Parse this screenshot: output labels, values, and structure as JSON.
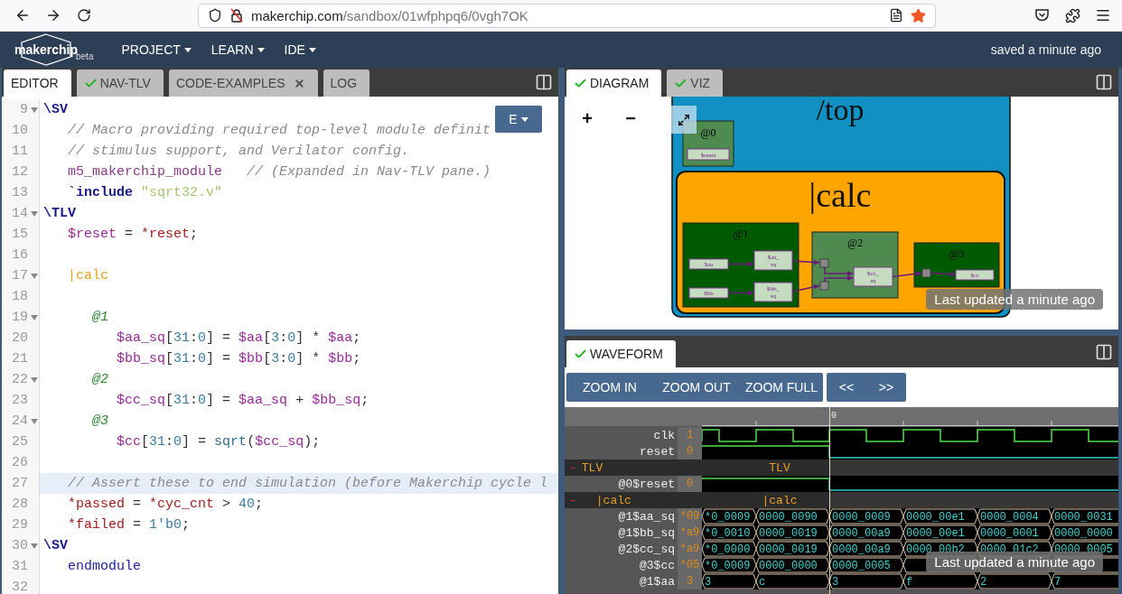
{
  "browser": {
    "url_host": "makerchip.com",
    "url_path": "/sandbox/01wfphpq6/0vgh7OK",
    "bookmarked": true
  },
  "navbar": {
    "logo": "makerchip",
    "badge": "beta",
    "menus": [
      "PROJECT",
      "LEARN",
      "IDE"
    ],
    "status": "saved a minute ago"
  },
  "editor": {
    "tabs": [
      {
        "label": "EDITOR",
        "selected": true,
        "ok": false,
        "closable": false
      },
      {
        "label": "NAV-TLV",
        "selected": false,
        "ok": true,
        "closable": false
      },
      {
        "label": "CODE-EXAMPLES",
        "selected": false,
        "ok": false,
        "closable": true
      },
      {
        "label": "LOG",
        "selected": false,
        "ok": false,
        "closable": false
      }
    ],
    "mode_button": "E",
    "lines": [
      {
        "number": "9",
        "fold": true,
        "active": false,
        "tokens": [
          {
            "kind": "kw",
            "text": "\\SV"
          }
        ]
      },
      {
        "number": "10",
        "fold": false,
        "active": false,
        "tokens": [
          {
            "kind": "cm",
            "text": "   // Macro providing required top-level module definit"
          }
        ]
      },
      {
        "number": "11",
        "fold": false,
        "active": false,
        "tokens": [
          {
            "kind": "cm",
            "text": "   // stimulus support, and Verilator config."
          }
        ]
      },
      {
        "number": "12",
        "fold": false,
        "active": false,
        "tokens": [
          {
            "kind": "macro",
            "text": "   m5_makerchip_module"
          },
          {
            "kind": "cm",
            "text": "   // (Expanded in Nav-TLV pane.)"
          }
        ]
      },
      {
        "number": "13",
        "fold": false,
        "active": false,
        "tokens": [
          {
            "kind": "kw",
            "text": "   `include "
          },
          {
            "kind": "str",
            "text": "\"sqrt32.v\""
          }
        ]
      },
      {
        "number": "14",
        "fold": true,
        "active": false,
        "tokens": [
          {
            "kind": "kw",
            "text": "\\TLV"
          }
        ]
      },
      {
        "number": "15",
        "fold": false,
        "active": false,
        "tokens": [
          {
            "kind": "sig",
            "text": "   $reset"
          },
          {
            "kind": "op",
            "text": " = "
          },
          {
            "kind": "ext",
            "text": "*reset"
          },
          {
            "kind": "op",
            "text": ";"
          }
        ]
      },
      {
        "number": "16",
        "fold": false,
        "active": false
      },
      {
        "number": "17",
        "fold": true,
        "active": false,
        "tokens": [
          {
            "kind": "pipe",
            "text": "   |calc"
          }
        ]
      },
      {
        "number": "18",
        "fold": false,
        "active": false
      },
      {
        "number": "19",
        "fold": true,
        "active": false,
        "tokens": [
          {
            "kind": "stage",
            "text": "      @1"
          }
        ]
      },
      {
        "number": "20",
        "fold": false,
        "active": false,
        "tokens": [
          {
            "kind": "sig",
            "text": "         $aa_sq"
          },
          {
            "kind": "op",
            "text": "["
          },
          {
            "kind": "num",
            "text": "31"
          },
          {
            "kind": "op",
            "text": ":"
          },
          {
            "kind": "num",
            "text": "0"
          },
          {
            "kind": "op",
            "text": "] = "
          },
          {
            "kind": "sig",
            "text": "$aa"
          },
          {
            "kind": "op",
            "text": "["
          },
          {
            "kind": "num",
            "text": "3"
          },
          {
            "kind": "op",
            "text": ":"
          },
          {
            "kind": "num",
            "text": "0"
          },
          {
            "kind": "op",
            "text": "] * "
          },
          {
            "kind": "sig",
            "text": "$aa"
          },
          {
            "kind": "op",
            "text": ";"
          }
        ]
      },
      {
        "number": "21",
        "fold": false,
        "active": false,
        "tokens": [
          {
            "kind": "sig",
            "text": "         $bb_sq"
          },
          {
            "kind": "op",
            "text": "["
          },
          {
            "kind": "num",
            "text": "31"
          },
          {
            "kind": "op",
            "text": ":"
          },
          {
            "kind": "num",
            "text": "0"
          },
          {
            "kind": "op",
            "text": "] = "
          },
          {
            "kind": "sig",
            "text": "$bb"
          },
          {
            "kind": "op",
            "text": "["
          },
          {
            "kind": "num",
            "text": "3"
          },
          {
            "kind": "op",
            "text": ":"
          },
          {
            "kind": "num",
            "text": "0"
          },
          {
            "kind": "op",
            "text": "] * "
          },
          {
            "kind": "sig",
            "text": "$bb"
          },
          {
            "kind": "op",
            "text": ";"
          }
        ]
      },
      {
        "number": "22",
        "fold": true,
        "active": false,
        "tokens": [
          {
            "kind": "stage",
            "text": "      @2"
          }
        ]
      },
      {
        "number": "23",
        "fold": false,
        "active": false,
        "tokens": [
          {
            "kind": "sig",
            "text": "         $cc_sq"
          },
          {
            "kind": "op",
            "text": "["
          },
          {
            "kind": "num",
            "text": "31"
          },
          {
            "kind": "op",
            "text": ":"
          },
          {
            "kind": "num",
            "text": "0"
          },
          {
            "kind": "op",
            "text": "] = "
          },
          {
            "kind": "sig",
            "text": "$aa_sq"
          },
          {
            "kind": "op",
            "text": " + "
          },
          {
            "kind": "sig",
            "text": "$bb_sq"
          },
          {
            "kind": "op",
            "text": ";"
          }
        ]
      },
      {
        "number": "24",
        "fold": true,
        "active": false,
        "tokens": [
          {
            "kind": "stage",
            "text": "      @3"
          }
        ]
      },
      {
        "number": "25",
        "fold": false,
        "active": false,
        "tokens": [
          {
            "kind": "sig",
            "text": "         $cc"
          },
          {
            "kind": "op",
            "text": "["
          },
          {
            "kind": "num",
            "text": "31"
          },
          {
            "kind": "op",
            "text": ":"
          },
          {
            "kind": "num",
            "text": "0"
          },
          {
            "kind": "op",
            "text": "] = "
          },
          {
            "kind": "fn",
            "text": "sqrt"
          },
          {
            "kind": "op",
            "text": "("
          },
          {
            "kind": "sig",
            "text": "$cc_sq"
          },
          {
            "kind": "op",
            "text": ");"
          }
        ]
      },
      {
        "number": "26",
        "fold": false,
        "active": false
      },
      {
        "number": "27",
        "fold": false,
        "active": true,
        "tokens": [
          {
            "kind": "cm",
            "text": "   // Assert these to end simulation (before Makerchip cycle l"
          }
        ]
      },
      {
        "number": "28",
        "fold": false,
        "active": false,
        "tokens": [
          {
            "kind": "ext",
            "text": "   *passed"
          },
          {
            "kind": "op",
            "text": " = "
          },
          {
            "kind": "ext",
            "text": "*cyc_cnt"
          },
          {
            "kind": "op",
            "text": " > "
          },
          {
            "kind": "num",
            "text": "40"
          },
          {
            "kind": "op",
            "text": ";"
          }
        ]
      },
      {
        "number": "29",
        "fold": false,
        "active": false,
        "tokens": [
          {
            "kind": "ext",
            "text": "   *failed"
          },
          {
            "kind": "op",
            "text": " = "
          },
          {
            "kind": "num",
            "text": "1'b0"
          },
          {
            "kind": "op",
            "text": ";"
          }
        ]
      },
      {
        "number": "30",
        "fold": true,
        "active": false,
        "tokens": [
          {
            "kind": "kw",
            "text": "\\SV"
          }
        ]
      },
      {
        "number": "31",
        "fold": false,
        "active": false,
        "tokens": [
          {
            "kind": "kwn",
            "text": "   endmodule"
          }
        ]
      },
      {
        "number": "32",
        "fold": false,
        "active": false
      }
    ]
  },
  "diagram": {
    "tabs": [
      {
        "label": "DIAGRAM",
        "selected": true,
        "ok": true,
        "closable": false
      },
      {
        "label": "VIZ",
        "selected": false,
        "ok": true,
        "closable": false
      }
    ],
    "zoom_in": "+",
    "zoom_out": "−",
    "scope": "/top",
    "stage0": {
      "label": "@0",
      "signals": [
        {
          "lines": [
            "$reset"
          ]
        }
      ]
    },
    "pipeline": {
      "label": "|calc",
      "stages": [
        {
          "label": "@1",
          "signals": [
            {
              "lines": [
                "$aa"
              ]
            },
            {
              "lines": [
                "$aa_",
                "sq"
              ]
            },
            {
              "lines": [
                "$bb"
              ]
            },
            {
              "lines": [
                "$bb_",
                "sq"
              ]
            }
          ]
        },
        {
          "label": "@2",
          "signals": [
            {
              "lines": [
                "$cc_",
                "sq"
              ]
            }
          ]
        },
        {
          "label": "@3",
          "signals": [
            {
              "lines": [
                "$cc"
              ]
            }
          ]
        }
      ]
    },
    "toast": "Last updated a minute ago"
  },
  "waveform": {
    "tabs": [
      {
        "label": "WAVEFORM",
        "selected": true,
        "ok": true,
        "closable": false
      }
    ],
    "zoom_buttons": [
      "ZOOM IN",
      "ZOOM OUT",
      "ZOOM FULL"
    ],
    "nav_buttons": [
      "<<",
      ">>"
    ],
    "time_label": "0",
    "rows": [
      {
        "kind": "clock",
        "name": "clk",
        "value": "1"
      },
      {
        "kind": "bit",
        "name": "reset",
        "value": "0",
        "segments": [
          true,
          true,
          false,
          false,
          false,
          false
        ]
      },
      {
        "kind": "group",
        "name": "TLV",
        "label": "TLV",
        "toggle": "-",
        "children": [
          {
            "kind": "bit",
            "name": "@0$reset",
            "value": "0",
            "segments": [
              true,
              true,
              false,
              false,
              false,
              false
            ]
          },
          {
            "kind": "group",
            "name": "|calc",
            "label": "|calc",
            "toggle": "-",
            "children": [
              {
                "kind": "bus",
                "name": "@1$aa_sq",
                "value": "*09",
                "cells": [
                  "*0_0009",
                  "0000_0090",
                  "0000_0009",
                  "0000_00e1",
                  "0000_0004",
                  "0000_0031"
                ]
              },
              {
                "kind": "bus",
                "name": "@1$bb_sq",
                "value": "*a9",
                "cells": [
                  "*0_0010",
                  "0000_0019",
                  "0000_00a9",
                  "0000_00e1",
                  "0000_0001",
                  "0000_0000"
                ]
              },
              {
                "kind": "bus",
                "name": "@2$cc_sq",
                "value": "*a9",
                "cells": [
                  "*0_0000",
                  "0000_0019",
                  "0000_00a9",
                  "0000_00b2",
                  "0000_01c2",
                  "0000_0005"
                ]
              },
              {
                "kind": "bus",
                "name": "@3$cc",
                "value": "*05",
                "cells": [
                  "*0_0009",
                  "0000_0000",
                  "0000_0005"
                ]
              },
              {
                "kind": "bus",
                "name": "@1$aa",
                "value": "3",
                "cells": [
                  "3",
                  "c",
                  "3",
                  "f",
                  "2",
                  "7"
                ]
              }
            ]
          }
        ]
      }
    ],
    "toast": "Last updated a minute ago"
  }
}
